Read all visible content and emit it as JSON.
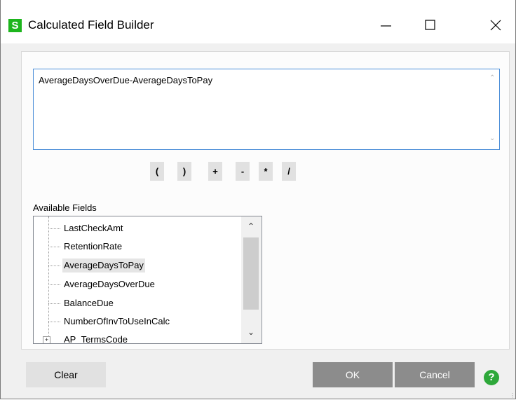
{
  "window": {
    "title": "Calculated Field Builder",
    "app_icon_letter": "S"
  },
  "formula": {
    "value": "AverageDaysOverDue-AverageDaysToPay"
  },
  "operators": [
    "(",
    ")",
    "+",
    "-",
    "*",
    "/"
  ],
  "available_fields": {
    "label": "Available Fields",
    "items": [
      {
        "label": "LastCheckAmt",
        "selected": false
      },
      {
        "label": "RetentionRate",
        "selected": false
      },
      {
        "label": "AverageDaysToPay",
        "selected": true
      },
      {
        "label": "AverageDaysOverDue",
        "selected": false
      },
      {
        "label": "BalanceDue",
        "selected": false
      },
      {
        "label": "NumberOfInvToUseInCalc",
        "selected": false
      },
      {
        "label": "AP_TermsCode",
        "selected": false,
        "expandable": true
      }
    ]
  },
  "buttons": {
    "clear": "Clear",
    "ok": "OK",
    "cancel": "Cancel",
    "help": "?"
  },
  "colors": {
    "accent_green": "#2ea83a",
    "formula_border": "#4a8dd8",
    "disabled_button": "#8c8c8c"
  }
}
